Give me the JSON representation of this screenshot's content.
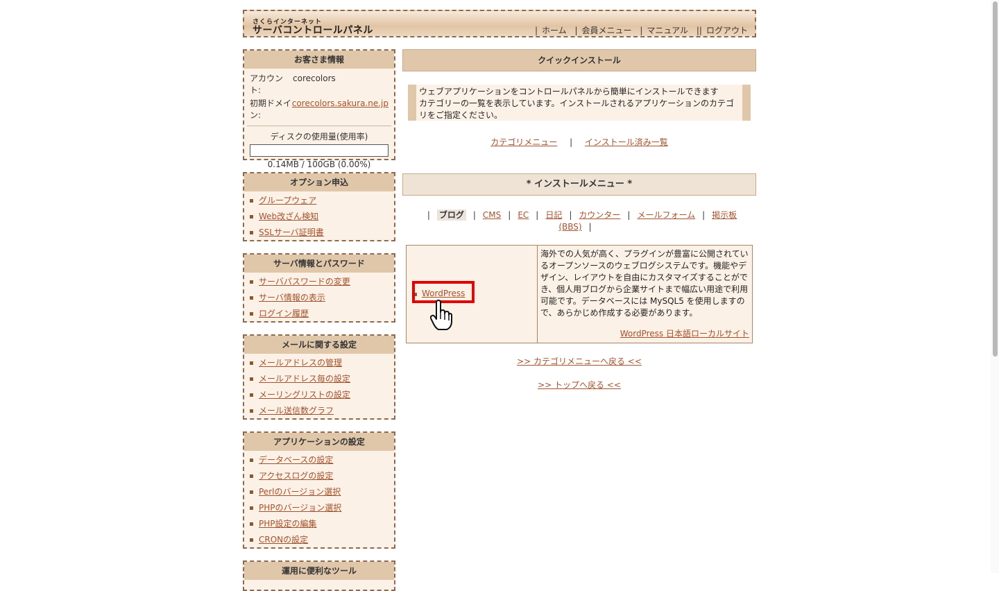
{
  "header": {
    "logo_small": "さくらインターネット",
    "logo_main": "サーバコントロールパネル",
    "nav": [
      "ホーム",
      "会員メニュー",
      "マニュアル",
      "ログアウト"
    ],
    "nav_separators": [
      "|",
      "|",
      "|",
      "||"
    ]
  },
  "sidebar": {
    "customer": {
      "title": "お客さま情報",
      "account_label": "アカウント:",
      "account_value": "corecolors",
      "domain_label": "初期ドメイン:",
      "domain_value": "corecolors.sakura.ne.jp",
      "disk_label": "ディスクの使用量(使用率)",
      "disk_value": "0.14MB / 100GB (0.00%)",
      "disk_usage_fraction": 0.0
    },
    "sections": [
      {
        "title": "オプション申込",
        "items": [
          "グループウェア",
          "Web改ざん検知",
          "SSLサーバ証明書"
        ]
      },
      {
        "title": "サーバ情報とパスワード",
        "items": [
          "サーバパスワードの変更",
          "サーバ情報の表示",
          "ログイン履歴"
        ]
      },
      {
        "title": "メールに関する設定",
        "items": [
          "メールアドレスの管理",
          "メールアドレス毎の設定",
          "メーリングリストの設定",
          "メール送信数グラフ"
        ]
      },
      {
        "title": "アプリケーションの設定",
        "items": [
          "データベースの設定",
          "アクセスログの設定",
          "Perlのバージョン選択",
          "PHPのバージョン選択",
          "PHP設定の編集",
          "CRONの設定"
        ]
      },
      {
        "title": "運用に便利なツール",
        "items": []
      }
    ]
  },
  "main": {
    "title": "クイックインストール",
    "intro_line1": "ウェブアプリケーションをコントロールパネルから簡単にインストールできます",
    "intro_line2": "カテゴリーの一覧を表示しています。インストールされるアプリケーションのカテゴリをご指定ください。",
    "links": {
      "category_menu": "カテゴリメニュー",
      "installed_list": "インストール済み一覧"
    },
    "install_menu_title": "* インストールメニュー *",
    "categories": {
      "active": "ブログ",
      "items": [
        "CMS",
        "EC",
        "日記",
        "カウンター",
        "メールフォーム",
        "掲示板(BBS)"
      ]
    },
    "app": {
      "name": "WordPress",
      "description": "海外での人気が高く、プラグインが豊富に公開されているオープンソースのウェブログシステムです。機能やデザイン、レイアウトを自由にカスタマイズすることができ、個人用ブログから企業サイトまで幅広い用途で利用可能です。データベースには MySQL5 を使用しますので、あらかじめ作成する必要があります。",
      "local_site": "WordPress 日本語ローカルサイト"
    },
    "back_to_category": ">> カテゴリメニューへ戻る <<",
    "back_to_top": ">> トップへ戻る <<"
  },
  "colors": {
    "accent_link": "#a0522d",
    "box_bg": "#fcf1e6",
    "box_title_bg": "#e0c7aa",
    "highlight": "#e00000"
  }
}
